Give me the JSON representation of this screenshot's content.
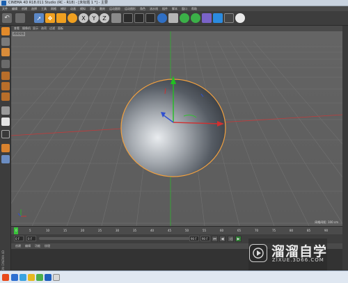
{
  "window": {
    "title": "CINEMA 4D R18.011 Studio (RC - R18) - [未标题 1 *] - 主要"
  },
  "menus": [
    "文件",
    "编辑",
    "创建",
    "选择",
    "工具",
    "网格",
    "捕捉",
    "动画",
    "模拟",
    "渲染",
    "雕刻",
    "运动跟踪",
    "运动图形",
    "角色",
    "流水线",
    "插件",
    "脚本",
    "窗口",
    "帮助"
  ],
  "toolbar": {
    "axis_x": "X",
    "axis_y": "Y",
    "axis_z": "Z",
    "colors": {
      "accent": "#f29a1a",
      "blue": "#2f6fc4",
      "green": "#3bb048"
    }
  },
  "viewport": {
    "menu": [
      "查看",
      "摄像机",
      "显示",
      "选项",
      "过滤",
      "面板"
    ],
    "label": "透视视图",
    "grid_info": "网格间距: 100 cm"
  },
  "timeline": {
    "ticks": [
      "0",
      "5",
      "10",
      "15",
      "20",
      "25",
      "30",
      "35",
      "40",
      "45",
      "50",
      "55",
      "60",
      "65",
      "70",
      "75",
      "80",
      "85",
      "90"
    ],
    "start_field": "0 F",
    "end_field": "90 F",
    "current_field": "0 F",
    "end_right": "90 F",
    "indicator": "0 F"
  },
  "lower_panel": {
    "menu": [
      "创建",
      "编辑",
      "功能",
      "纹理"
    ]
  },
  "logo_vertical": "MAXON CINEMA 4D",
  "watermark": {
    "title": "溜溜自学",
    "url": "ZIXUE.3D66.COM"
  }
}
